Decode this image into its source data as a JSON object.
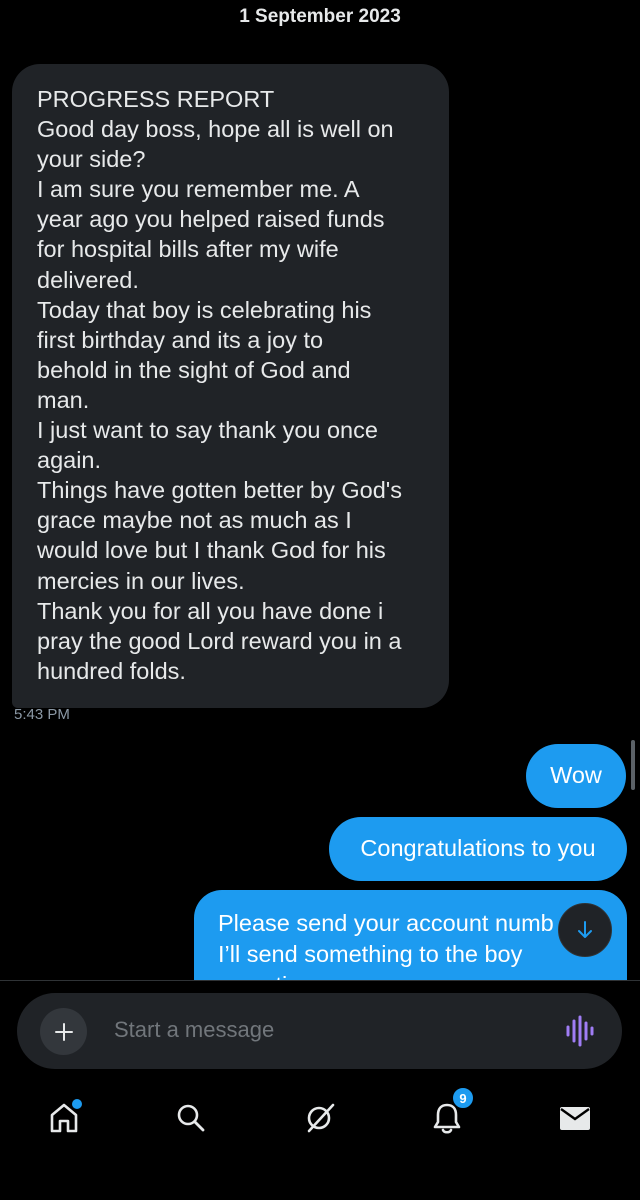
{
  "conversation": {
    "date_header": "1 September 2023",
    "incoming": {
      "lines": [
        "PROGRESS REPORT",
        "Good day boss, hope all is well on",
        "your side?",
        "I am sure you remember me. A",
        "year ago you helped raised funds",
        "for hospital bills after my wife",
        "delivered.",
        "Today that boy is celebrating his",
        "first birthday and its a joy to",
        "behold in the sight of God and",
        "man.",
        "I just want to say thank you once",
        "again.",
        "Things have gotten better by God's",
        "grace maybe not as much as I",
        "would love but I thank God for his",
        "mercies in our lives.",
        "Thank you for all you have done i",
        "pray the good Lord reward you in a",
        "hundred folds."
      ],
      "time": "5:43 PM"
    },
    "outgoing": [
      {
        "text": "Wow"
      },
      {
        "text": "Congratulations to you"
      },
      {
        "lines": [
          "Please send your account numb",
          "I’ll send something to the boy",
          "sometime soon"
        ]
      }
    ]
  },
  "composer": {
    "placeholder": "Start a message"
  },
  "nav": {
    "notifications_count": "9"
  },
  "colors": {
    "accent": "#1d9bf0",
    "incoming_bubble": "#202327",
    "voice_icon": "#a07df5"
  }
}
